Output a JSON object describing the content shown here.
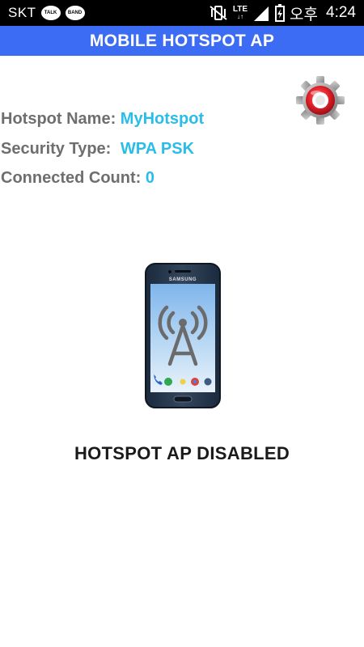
{
  "status_bar": {
    "carrier": "SKT",
    "badges": [
      "TALK",
      "BAND"
    ],
    "network": "LTE",
    "clock_label": "오후",
    "time": "4:24",
    "icons": [
      "kakaotalk-icon",
      "band-icon",
      "vibrate-icon",
      "lte-icon",
      "signal-icon",
      "battery-icon"
    ]
  },
  "header": {
    "title": "MOBILE HOTSPOT AP"
  },
  "settings": {
    "icon": "gear-icon"
  },
  "info": {
    "hotspot_name_label": "Hotspot Name:",
    "hotspot_name_value": "MyHotspot",
    "security_type_label": "Security Type:",
    "security_type_value": "WPA PSK",
    "connected_count_label": "Connected Count:",
    "connected_count_value": "0"
  },
  "illustration": {
    "brand": "SAMSUNG",
    "icon": "broadcast-tower-icon"
  },
  "status_message": "HOTSPOT AP DISABLED",
  "colors": {
    "title_bar": "#3d6cf4",
    "value_text": "#29bde8",
    "label_text": "#6e6e6e",
    "gear_accent": "#e0202a"
  }
}
